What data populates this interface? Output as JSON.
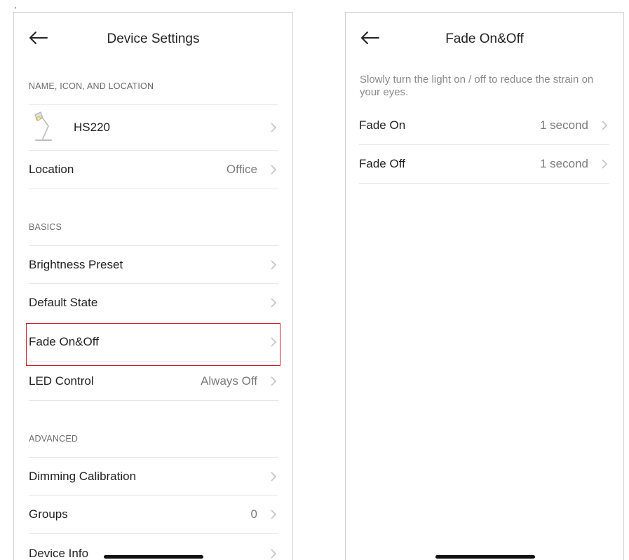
{
  "marker": ".",
  "left_screen": {
    "title": "Device Settings",
    "sections": {
      "name_icon_location": "NAME, ICON, AND LOCATION",
      "basics": "BASICS",
      "advanced": "ADVANCED"
    },
    "device": {
      "name": "HS220",
      "icon": "desk-lamp-icon"
    },
    "location": {
      "label": "Location",
      "value": "Office"
    },
    "basics_items": [
      {
        "label": "Brightness Preset",
        "value": ""
      },
      {
        "label": "Default State",
        "value": ""
      },
      {
        "label": "Fade On&Off",
        "value": ""
      },
      {
        "label": "LED Control",
        "value": "Always Off"
      }
    ],
    "advanced_items": [
      {
        "label": "Dimming Calibration",
        "value": ""
      },
      {
        "label": "Groups",
        "value": "0"
      },
      {
        "label": "Device Info",
        "value": ""
      }
    ]
  },
  "right_screen": {
    "title": "Fade On&Off",
    "description": "Slowly turn the light on / off to reduce the strain on your eyes.",
    "items": [
      {
        "label": "Fade On",
        "value": "1 second"
      },
      {
        "label": "Fade Off",
        "value": "1 second"
      }
    ]
  },
  "colors": {
    "highlight": "#c8202a",
    "chevron": "#c4c4c4",
    "divider": "#e6e6e6"
  }
}
